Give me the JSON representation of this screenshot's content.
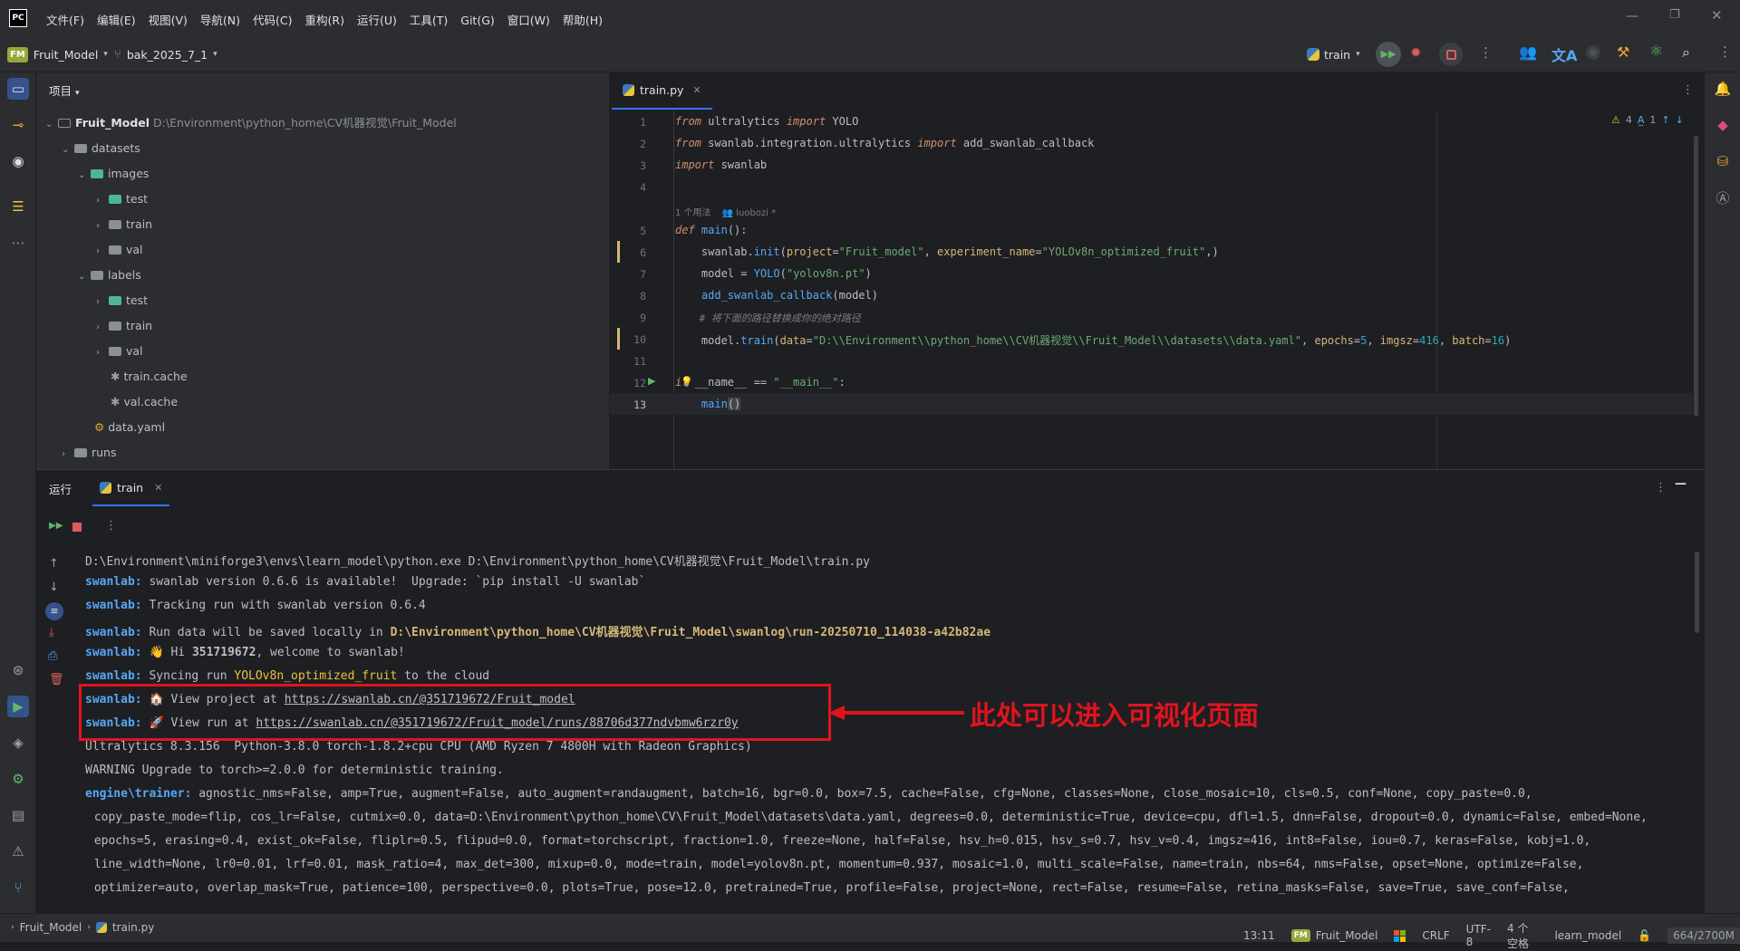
{
  "menu": [
    "文件(F)",
    "编辑(E)",
    "视图(V)",
    "导航(N)",
    "代码(C)",
    "重构(R)",
    "运行(U)",
    "工具(T)",
    "Git(G)",
    "窗口(W)",
    "帮助(H)"
  ],
  "app_badge": "PC",
  "project_badge": "FM",
  "project_name": "Fruit_Model",
  "branch": "bak_2025_7_1",
  "run_config": "train",
  "project_panel": {
    "title": "项目",
    "root_name": "Fruit_Model",
    "root_path": "D:\\Environment\\python_home\\CV机器视觉\\Fruit_Model",
    "items": [
      "datasets",
      "images",
      "test",
      "train",
      "val",
      "labels",
      "test",
      "train",
      "val",
      "train.cache",
      "val.cache",
      "data.yaml",
      "runs"
    ]
  },
  "editor": {
    "tab": "train.py",
    "warnings": "4",
    "typos": "1",
    "usage_hint": "1 个用法",
    "author_hint": "luobozi *",
    "line_numbers": [
      "1",
      "2",
      "3",
      "4",
      "5",
      "6",
      "7",
      "8",
      "9",
      "10",
      "11",
      "12",
      "13"
    ],
    "lines": {
      "l1": [
        "from",
        " ultralytics ",
        "import",
        " YOLO"
      ],
      "l2": [
        "from",
        " swanlab.integration.ultralytics ",
        "import",
        " add_swanlab_callback"
      ],
      "l3": [
        "import",
        " swanlab"
      ],
      "l5": [
        "def",
        " ",
        "main",
        "():"
      ],
      "l6": [
        "    swanlab.",
        "init",
        "(",
        "project",
        "=",
        "\"Fruit_model\"",
        ", ",
        "experiment_name",
        "=",
        "\"YOLOv8n_optimized_fruit\"",
        ",)"
      ],
      "l7": [
        "    model = ",
        "YOLO",
        "(",
        "\"yolov8n.pt\"",
        ")"
      ],
      "l8": [
        "    ",
        "add_swanlab_callback",
        "(model)"
      ],
      "l9": "    # 将下面的路径替换成你的绝对路径",
      "l10": [
        "    model.",
        "train",
        "(",
        "data",
        "=",
        "\"D:\\\\Environment\\\\python_home\\\\CV机器视觉\\\\Fruit_Model\\\\datasets\\\\data.yaml\"",
        ", ",
        "epochs",
        "=",
        "5",
        ", ",
        "imgsz",
        "=",
        "416",
        ", ",
        "batch",
        "=",
        "16",
        ")"
      ],
      "l12": [
        "if",
        " __name__ == ",
        "\"__main__\"",
        ":"
      ],
      "l13": [
        "    ",
        "main",
        "()"
      ]
    }
  },
  "run_panel": {
    "title": "运行",
    "tab": "train",
    "console": {
      "c1": "D:\\Environment\\miniforge3\\envs\\learn_model\\python.exe D:\\Environment\\python_home\\CV机器视觉\\Fruit_Model\\train.py",
      "tag": "swanlab:",
      "c2": " swanlab version 0.6.6 is available!  Upgrade: `pip install -U swanlab`",
      "c3": " Tracking run with swanlab version 0.6.4",
      "c4a": " Run data will be saved locally in ",
      "c4b": "D:\\Environment\\python_home\\CV机器视觉\\Fruit_Model\\swanlog\\run-20250710_114038-a42b82ae",
      "c5a": " 👋 Hi ",
      "c5b": "351719672",
      "c5c": ", welcome to swanlab!",
      "c6a": " Syncing run ",
      "c6b": "YOLOv8n_optimized_fruit",
      "c6c": " to the cloud",
      "c7a": " 🏠 View project at ",
      "c7b": "https://swanlab.cn/@351719672/Fruit_model",
      "c8a": " 🚀 View run at ",
      "c8b": "https://swanlab.cn/@351719672/Fruit_model/runs/88706d377ndvbmw6rzr0y",
      "c9": "Ultralytics 8.3.156  Python-3.8.0 torch-1.8.2+cpu CPU (AMD Ryzen 7 4800H with Radeon Graphics)",
      "c10": "WARNING Upgrade to torch>=2.0.0 for deterministic training.",
      "c11a": "engine\\trainer:",
      "c11b": " agnostic_nms=False, amp=True, augment=False, auto_augment=randaugment, batch=16, bgr=0.0, box=7.5, cache=False, cfg=None, classes=None, close_mosaic=10, cls=0.5, conf=None, copy_paste=0.0,",
      "c12": " copy_paste_mode=flip, cos_lr=False, cutmix=0.0, data=D:\\Environment\\python_home\\CV\\Fruit_Model\\datasets\\data.yaml, degrees=0.0, deterministic=True, device=cpu, dfl=1.5, dnn=False, dropout=0.0, dynamic=False, embed=None,",
      "c13": " epochs=5, erasing=0.4, exist_ok=False, fliplr=0.5, flipud=0.0, format=torchscript, fraction=1.0, freeze=None, half=False, hsv_h=0.015, hsv_s=0.7, hsv_v=0.4, imgsz=416, int8=False, iou=0.7, keras=False, kobj=1.0,",
      "c14": " line_width=None, lr0=0.01, lrf=0.01, mask_ratio=4, max_det=300, mixup=0.0, mode=train, model=yolov8n.pt, momentum=0.937, mosaic=1.0, multi_scale=False, name=train, nbs=64, nms=False, opset=None, optimize=False,",
      "c15": " optimizer=auto, overlap_mask=True, patience=100, perspective=0.0, plots=True, pose=12.0, pretrained=True, profile=False, project=None, rect=False, resume=False, retina_masks=False, save=True, save_conf=False,"
    }
  },
  "annotation": "此处可以进入可视化页面",
  "status": {
    "crumb_project": "Fruit_Model",
    "crumb_file": "train.py",
    "position": "13:11",
    "badge": "FM",
    "module": "Fruit_Model",
    "line_sep": "CRLF",
    "encoding": "UTF-8",
    "indent": "4 个空格",
    "interpreter": "learn_model",
    "memory": "664/2700M"
  }
}
